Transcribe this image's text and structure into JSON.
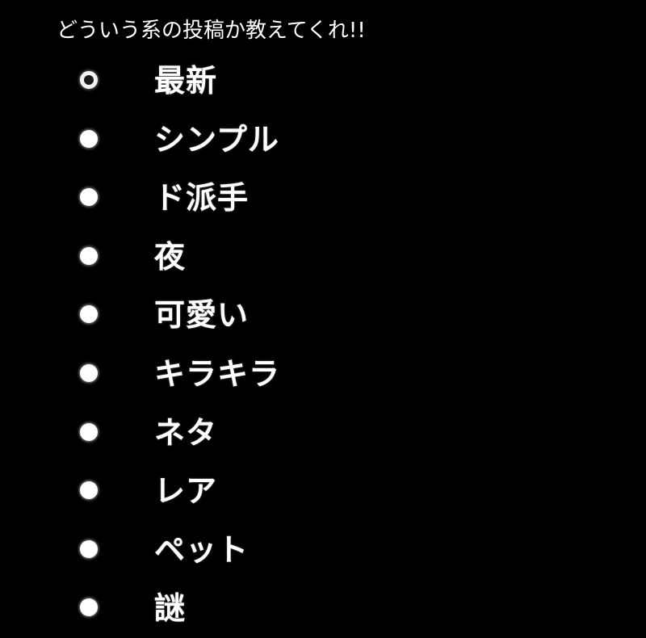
{
  "poll": {
    "question": "どういう系の投稿か教えてくれ!!",
    "selected_index": 0,
    "options": [
      {
        "label": "最新"
      },
      {
        "label": "シンプル"
      },
      {
        "label": "ド派手"
      },
      {
        "label": "夜"
      },
      {
        "label": "可愛い"
      },
      {
        "label": "キラキラ"
      },
      {
        "label": "ネタ"
      },
      {
        "label": "レア"
      },
      {
        "label": "ペット"
      },
      {
        "label": "謎"
      }
    ]
  },
  "colors": {
    "background": "#000000",
    "text": "#ffffff",
    "radio_fill": "#ffffff",
    "radio_selected_center": "#1a1a1a"
  },
  "icons": {
    "radio_unselected": "radio-unselected-icon",
    "radio_selected": "radio-selected-icon"
  }
}
